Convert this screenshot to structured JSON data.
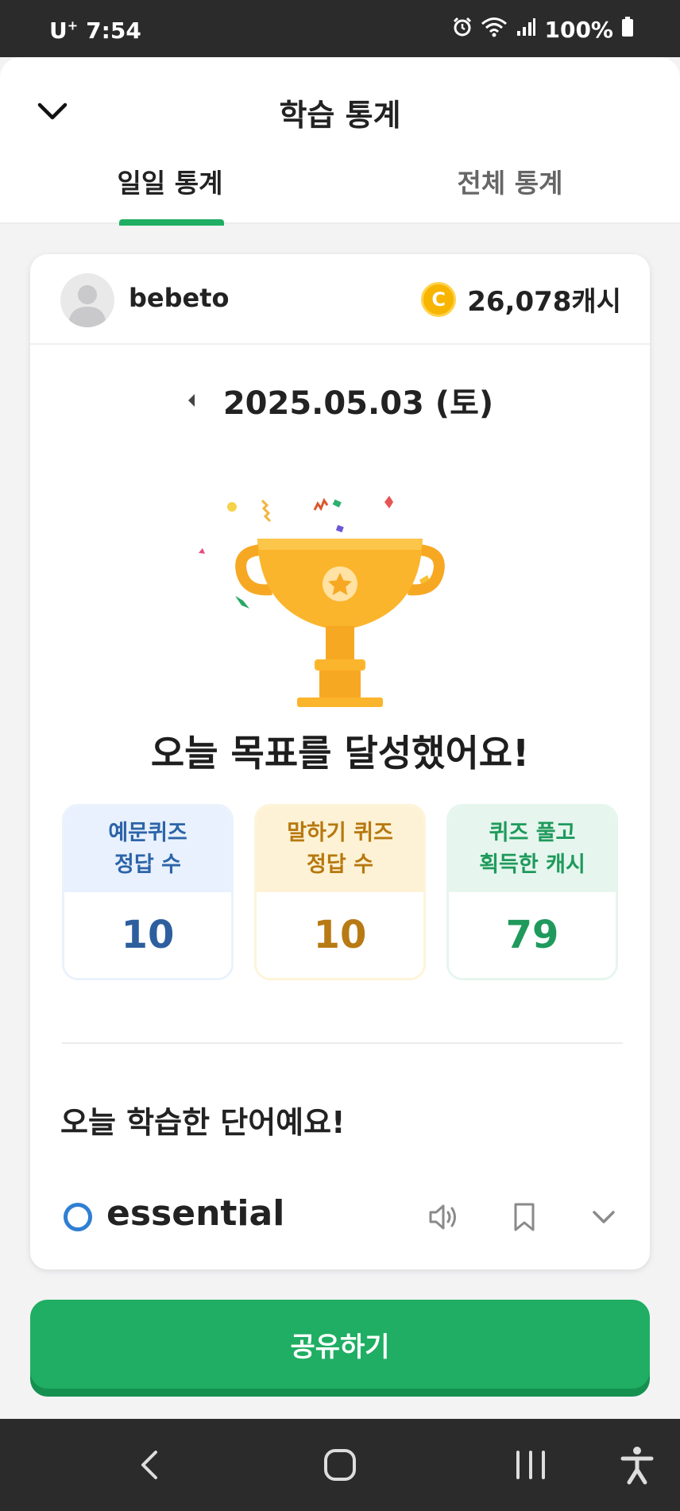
{
  "status_bar": {
    "carrier": "U",
    "carrier_sup": "+",
    "time": "7:54",
    "battery": "100%",
    "icons": [
      "alarm-icon",
      "wifi-icon",
      "signal-icon",
      "battery-icon"
    ]
  },
  "header": {
    "title": "학습 통계",
    "close_icon": "chevron-down-icon"
  },
  "tabs": [
    {
      "label": "일일 통계",
      "active": true
    },
    {
      "label": "전체 통계",
      "active": false
    }
  ],
  "user": {
    "name": "bebeto",
    "cash": "26,078캐시",
    "coin_letter": "C"
  },
  "date": {
    "value": "2025.05.03 (토)"
  },
  "achievement": {
    "message": "오늘 목표를 달성했어요!"
  },
  "stats": [
    {
      "label_line1": "예문퀴즈",
      "label_line2": "정답 수",
      "value": "10"
    },
    {
      "label_line1": "말하기 퀴즈",
      "label_line2": "정답 수",
      "value": "10"
    },
    {
      "label_line1": "퀴즈 풀고",
      "label_line2": "획득한 캐시",
      "value": "79"
    }
  ],
  "learned": {
    "title": "오늘 학습한 단어예요!",
    "words": [
      {
        "word": "essential"
      }
    ]
  },
  "share_button": {
    "label": "공유하기"
  },
  "colors": {
    "brand_green": "#1fae63",
    "coin": "#f7b500",
    "trophy": "#fbb52c"
  }
}
